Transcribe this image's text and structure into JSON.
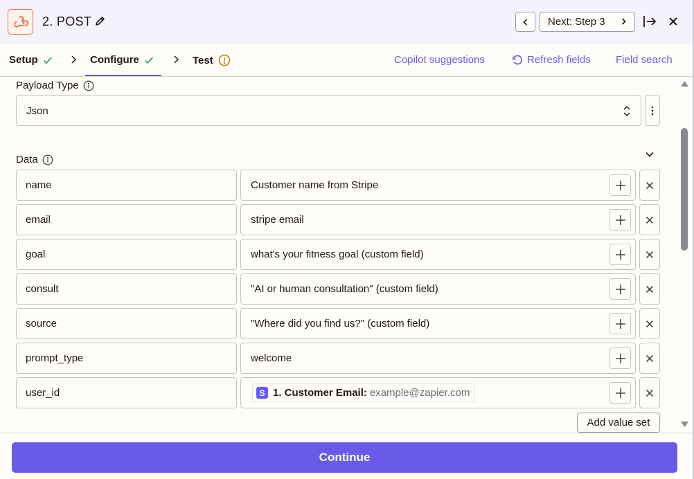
{
  "header": {
    "step_title": "2. POST",
    "next_label": "Next: Step 3"
  },
  "tabs": [
    {
      "label": "Setup",
      "status": "complete"
    },
    {
      "label": "Configure",
      "status": "complete",
      "active": true
    },
    {
      "label": "Test",
      "status": "warning"
    }
  ],
  "top_links": {
    "copilot": "Copilot suggestions",
    "refresh": "Refresh fields",
    "field_search": "Field search"
  },
  "payload_type": {
    "label": "Payload Type",
    "value": "Json"
  },
  "data_section": {
    "label": "Data",
    "rows": [
      {
        "key": "name",
        "value": "Customer name from Stripe"
      },
      {
        "key": "email",
        "value": "stripe email"
      },
      {
        "key": "goal",
        "value": "what's your fitness goal (custom field)"
      },
      {
        "key": "consult",
        "value": "\"AI or human consultation\" (custom field)"
      },
      {
        "key": "source",
        "value": "\"Where did you find us?\" (custom field)"
      },
      {
        "key": "prompt_type",
        "value": "welcome"
      },
      {
        "key": "user_id",
        "pill": {
          "badge": "S",
          "label": "1. Customer Email:",
          "sample": "example@zapier.com"
        }
      }
    ],
    "add_value_set": "Add value set"
  },
  "footer": {
    "continue_label": "Continue"
  },
  "colors": {
    "accent": "#695be8",
    "success": "#3ba55c",
    "warning": "#b08800",
    "webhook_orange": "#f06c3c",
    "stripe": "#635bff"
  }
}
